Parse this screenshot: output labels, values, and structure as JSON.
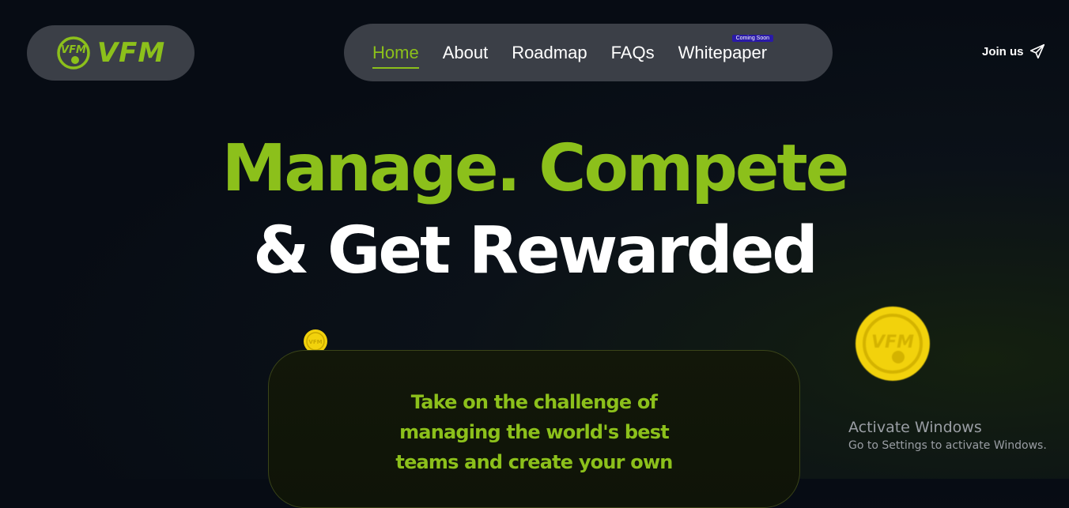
{
  "brand": {
    "name": "VFM",
    "logo_icon": "vfm-ball-badge-icon",
    "accent_color": "#8cc01b"
  },
  "nav": {
    "items": [
      {
        "label": "Home",
        "active": true
      },
      {
        "label": "About",
        "active": false
      },
      {
        "label": "Roadmap",
        "active": false
      },
      {
        "label": "FAQs",
        "active": false
      },
      {
        "label": "Whitepaper",
        "active": false,
        "badge": "Coming Soon"
      }
    ]
  },
  "join": {
    "label": "Join us",
    "icon": "paper-plane-icon"
  },
  "hero": {
    "line1": "Manage. Compete",
    "line2": "& Get Rewarded"
  },
  "card": {
    "lines": [
      "Take on the challenge of",
      "managing the world's best",
      "teams and create your own"
    ]
  },
  "coins": {
    "icon": "vfm-coin-icon",
    "color": "#f2d20c"
  },
  "overlay": {
    "title": "Activate Windows",
    "subtitle": "Go to Settings to activate Windows."
  }
}
